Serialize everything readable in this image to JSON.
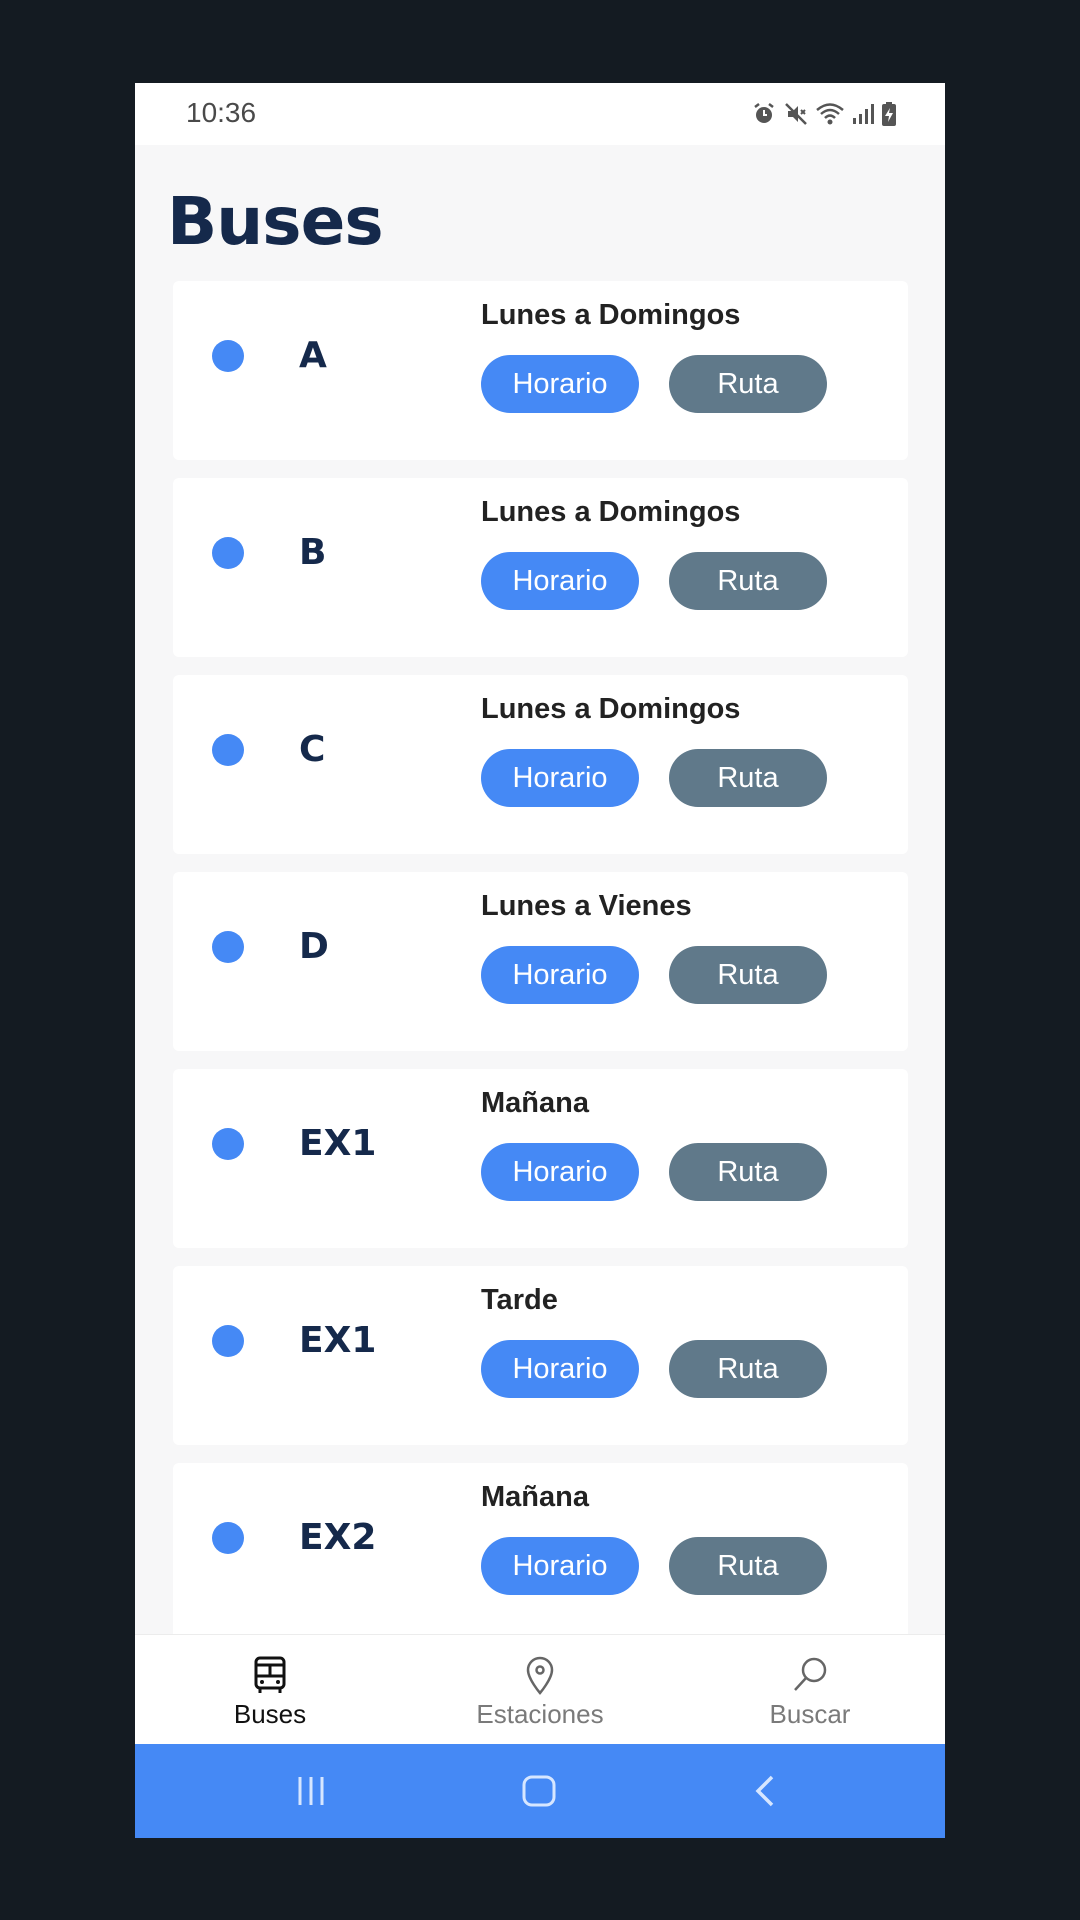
{
  "status_bar": {
    "time": "10:36",
    "icons": [
      "alarm-icon",
      "mute-icon",
      "wifi-icon",
      "signal-icon",
      "battery-charging-icon"
    ]
  },
  "page": {
    "title": "Buses"
  },
  "routes": [
    {
      "name": "A",
      "days": "Lunes a Domingos",
      "schedule_label": "Horario",
      "route_label": "Ruta"
    },
    {
      "name": "B",
      "days": "Lunes a Domingos",
      "schedule_label": "Horario",
      "route_label": "Ruta"
    },
    {
      "name": "C",
      "days": "Lunes a Domingos",
      "schedule_label": "Horario",
      "route_label": "Ruta"
    },
    {
      "name": "D",
      "days": "Lunes a Vienes",
      "schedule_label": "Horario",
      "route_label": "Ruta"
    },
    {
      "name": "EX1",
      "days": "Mañana",
      "schedule_label": "Horario",
      "route_label": "Ruta"
    },
    {
      "name": "EX1",
      "days": "Tarde",
      "schedule_label": "Horario",
      "route_label": "Ruta"
    },
    {
      "name": "EX2",
      "days": "Mañana",
      "schedule_label": "Horario",
      "route_label": "Ruta"
    }
  ],
  "bottom_nav": {
    "items": [
      {
        "label": "Buses",
        "icon": "bus-icon",
        "active": true
      },
      {
        "label": "Estaciones",
        "icon": "location-pin-icon",
        "active": false
      },
      {
        "label": "Buscar",
        "icon": "search-icon",
        "active": false
      }
    ]
  },
  "system_nav": {
    "icons": [
      "recent-apps-icon",
      "home-icon",
      "back-icon"
    ]
  },
  "colors": {
    "accent": "#4589f5",
    "route_button": "#60798a",
    "title": "#15294b"
  }
}
